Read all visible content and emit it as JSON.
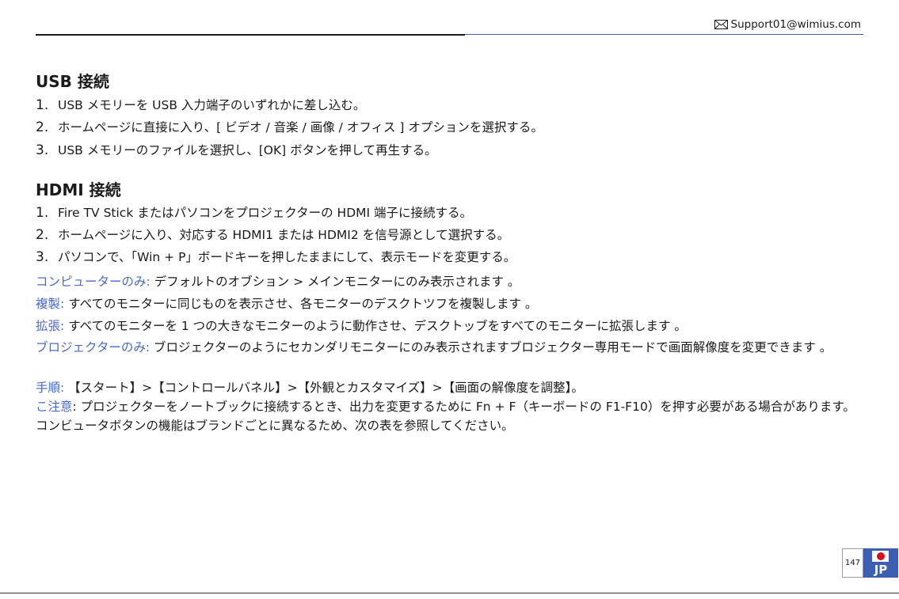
{
  "header": {
    "email": "Support01@wimius.com",
    "email_icon": "envelope-icon"
  },
  "usb": {
    "title": "USB 接続",
    "steps": [
      {
        "num": "1.",
        "text": "USB メモリーを USB 入力端子のいずれかに差し込む。"
      },
      {
        "num": "2.",
        "text": "ホームページに直接に入り、[ ビデオ / 音楽 / 画像 / オフィス ] オプションを選択する。"
      },
      {
        "num": "3.",
        "text": "USB メモリーのファイルを選択し、[OK] ボタンを押して再生する。"
      }
    ]
  },
  "hdmi": {
    "title": "HDMI 接続",
    "steps": [
      {
        "num": "1.",
        "text": "Fire TV Stick またはパソコンをプロジェクターの HDMI 端子に接続する。"
      },
      {
        "num": "2.",
        "text": "ホームページに入り、対応する HDMI1 または HDMI2 を信号源として選択する。"
      },
      {
        "num": "3.",
        "text": "パソコンで、「Win + P」ボードキーを押したままにして、表示モードを変更する。"
      }
    ]
  },
  "notes": [
    {
      "label": "コンピューターのみ:",
      "text": " デフォルトのオブション > メインモニターにのみ表示されます 。"
    },
    {
      "label": "複製:",
      "text": " すべてのモニターに同じものを表示させ、各モニターのデスクトツフを複製します 。"
    },
    {
      "label": "拡張:",
      "text": " すべてのモニターを 1 つの大きなモニターのように動作させ、デスクトッブをすべてのモニターに拡張します 。"
    },
    {
      "label": "ブロジェクターのみ:",
      "text": " ブロジェクターのようにセカンダリモニターにのみ表示されますブロジェクター専用モードで画面解像度を変更できます 。"
    },
    {
      "label": "手順:",
      "text": " 【スタート】>【コントロールバネル】>【外観とカスタマイズ】>【画面の解像度を調整】。"
    },
    {
      "label": "こ注意",
      "text": ": プロジェクターをノートブックに接続するとき、出力を変更するために Fn + F（キーボードの F1-F10）を押す必要がある場合があります。コンビュータボタンの機能はブランドごとに異なるため、次の表を参照してください。"
    }
  ],
  "footer": {
    "page_number": "147",
    "lang_code": "JP"
  },
  "colors": {
    "accent_blue": "#4a6ac9",
    "badge_blue": "#3b5fb3",
    "flag_red": "#d8101c"
  }
}
